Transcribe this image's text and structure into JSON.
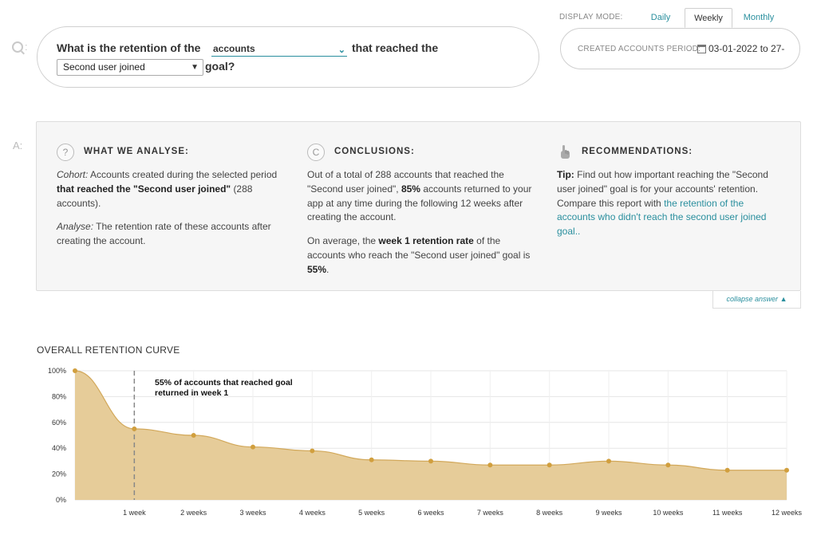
{
  "question": {
    "part1": "What is the retention of the",
    "entity": "accounts",
    "part2": "that reached the",
    "goal": "Second user joined",
    "part3": "goal?"
  },
  "display_mode": {
    "label": "DISPLAY MODE:",
    "options": [
      "Daily",
      "Weekly",
      "Monthly"
    ],
    "selected": "Weekly"
  },
  "period": {
    "label": "CREATED ACCOUNTS PERIOD:",
    "value": "03-01-2022 to 27-"
  },
  "answer": {
    "what_we_analyse": {
      "icon": "?",
      "title": "WHAT WE ANALYSE:",
      "cohort_label": "Cohort:",
      "cohort_text": "Accounts created during the selected period",
      "cohort_bold": "that reached the \"Second user joined\"",
      "cohort_count": "(288 accounts).",
      "analyse_label": "Analyse:",
      "analyse_text": "The retention rate of these accounts after creating the account."
    },
    "conclusions": {
      "icon": "C",
      "title": "CONCLUSIONS:",
      "p1_a": "Out of a total of 288 accounts that reached the \"Second user joined\",",
      "p1_bold": "85%",
      "p1_b": "accounts returned to your app at any time during the following 12 weeks after creating the account.",
      "p2_a": "On average, the",
      "p2_bold": "week 1 retention rate",
      "p2_b": "of the accounts who reach the \"Second user joined\" goal is",
      "p2_value": "55%",
      "p2_end": "."
    },
    "recommendations": {
      "title": "RECOMMENDATIONS:",
      "tip_label": "Tip:",
      "tip_text": "Find out how important reaching the \"Second user joined\" goal is for your accounts' retention. Compare this report with",
      "tip_link": "the retention of the accounts who didn't reach the second user joined goal.."
    },
    "collapse_label": "collapse answer"
  },
  "chart": {
    "title": "OVERALL RETENTION CURVE",
    "annotation_line1": "55% of accounts that reached goal",
    "annotation_line2": "returned in week 1"
  },
  "chart_data": {
    "type": "area",
    "x": [
      "0",
      "1 week",
      "2 weeks",
      "3 weeks",
      "4 weeks",
      "5 weeks",
      "6 weeks",
      "7 weeks",
      "8 weeks",
      "9 weeks",
      "10 weeks",
      "11 weeks",
      "12 weeks"
    ],
    "x_tick_labels": [
      "1 week",
      "2 weeks",
      "3 weeks",
      "4 weeks",
      "5 weeks",
      "6 weeks",
      "7 weeks",
      "8 weeks",
      "9 weeks",
      "10 weeks",
      "11 weeks",
      "12 weeks"
    ],
    "values": [
      100,
      55,
      50,
      41,
      38,
      31,
      30,
      27,
      27,
      30,
      27,
      23,
      23
    ],
    "y_ticks": [
      "0%",
      "20%",
      "40%",
      "60%",
      "80%",
      "100%"
    ],
    "ylim": [
      0,
      100
    ],
    "grid": true,
    "marker_at": "1 week",
    "colors": {
      "fill": "#e6cc99",
      "line": "#d2a85a",
      "point": "#d19f3e",
      "marker": "#888888"
    }
  }
}
